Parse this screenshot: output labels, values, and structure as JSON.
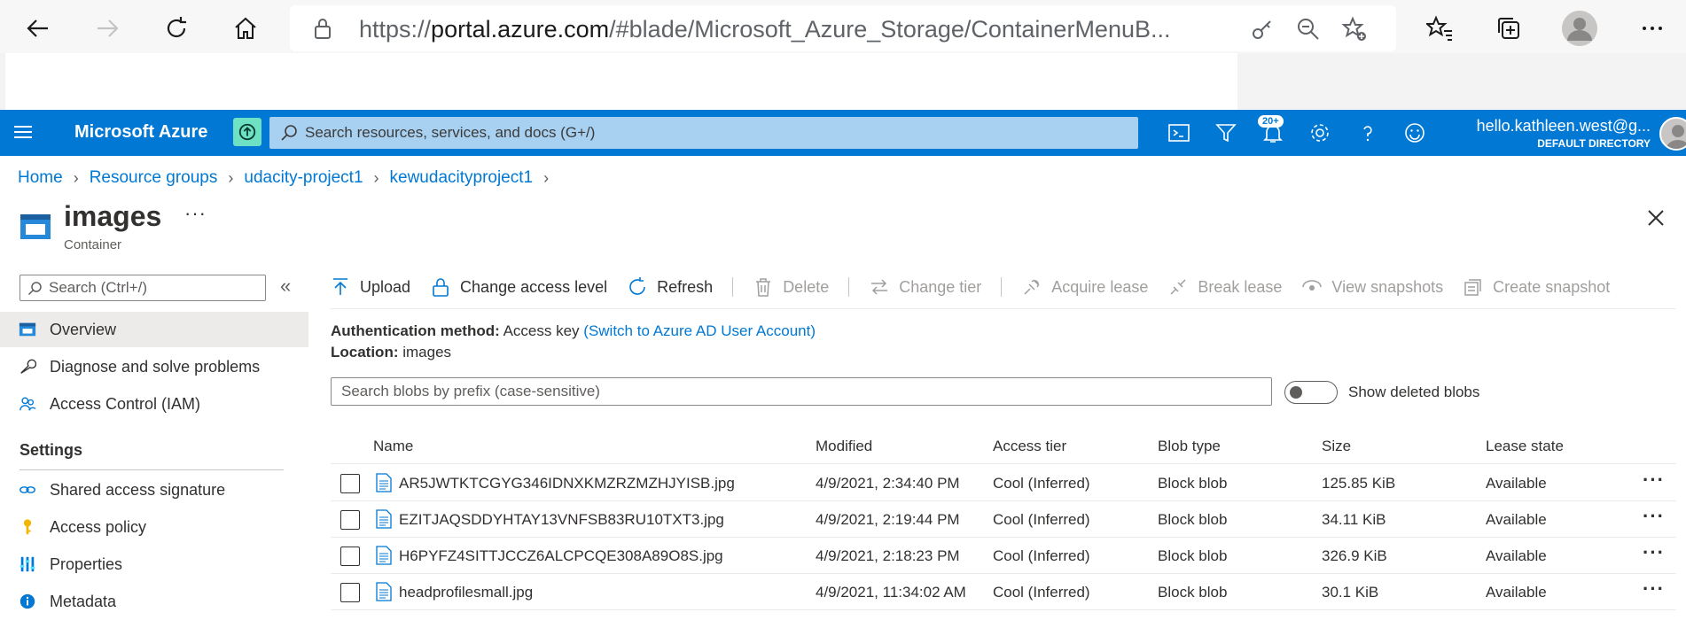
{
  "browser": {
    "url_prefix": "https://",
    "url_host": "portal.azure.com",
    "url_rest": "/#blade/Microsoft_Azure_Storage/ContainerMenuB..."
  },
  "header": {
    "brand": "Microsoft Azure",
    "search_placeholder": "Search resources, services, and docs (G+/)",
    "notification_count": "20+",
    "email": "hello.kathleen.west@g...",
    "directory": "DEFAULT DIRECTORY"
  },
  "breadcrumb": [
    "Home",
    "Resource groups",
    "udacity-project1",
    "kewudacityproject1"
  ],
  "page": {
    "title": "images",
    "subtitle": "Container",
    "more": "···"
  },
  "nav": {
    "search_placeholder": "Search (Ctrl+/)",
    "collapse": "«",
    "items": [
      {
        "label": "Overview",
        "icon": "container-icon"
      },
      {
        "label": "Diagnose and solve problems",
        "icon": "wrench-icon"
      },
      {
        "label": "Access Control (IAM)",
        "icon": "people-icon"
      }
    ],
    "section": "Settings",
    "settings_items": [
      {
        "label": "Shared access signature",
        "icon": "link-icon"
      },
      {
        "label": "Access policy",
        "icon": "key-icon"
      },
      {
        "label": "Properties",
        "icon": "properties-icon"
      },
      {
        "label": "Metadata",
        "icon": "info-icon"
      }
    ]
  },
  "toolbar": {
    "upload": "Upload",
    "change_access": "Change access level",
    "refresh": "Refresh",
    "delete": "Delete",
    "change_tier": "Change tier",
    "acquire_lease": "Acquire lease",
    "break_lease": "Break lease",
    "view_snapshots": "View snapshots",
    "create_snapshot": "Create snapshot"
  },
  "info": {
    "auth_label": "Authentication method:",
    "auth_value": "Access key",
    "auth_link": "(Switch to Azure AD User Account)",
    "location_label": "Location:",
    "location_value": "images"
  },
  "blob_search_placeholder": "Search blobs by prefix (case-sensitive)",
  "show_deleted_label": "Show deleted blobs",
  "table": {
    "columns": [
      "Name",
      "Modified",
      "Access tier",
      "Blob type",
      "Size",
      "Lease state"
    ],
    "rows": [
      {
        "name": "AR5JWTKTCGYG346IDNXKMZRZMZHJYISB.jpg",
        "modified": "4/9/2021, 2:34:40 PM",
        "tier": "Cool (Inferred)",
        "type": "Block blob",
        "size": "125.85 KiB",
        "lease": "Available"
      },
      {
        "name": "EZITJAQSDDYHTAY13VNFSB83RU10TXT3.jpg",
        "modified": "4/9/2021, 2:19:44 PM",
        "tier": "Cool (Inferred)",
        "type": "Block blob",
        "size": "34.11 KiB",
        "lease": "Available"
      },
      {
        "name": "H6PYFZ4SITTJCCZ6ALCPCQE308A89O8S.jpg",
        "modified": "4/9/2021, 2:18:23 PM",
        "tier": "Cool (Inferred)",
        "type": "Block blob",
        "size": "326.9 KiB",
        "lease": "Available"
      },
      {
        "name": "headprofilesmall.jpg",
        "modified": "4/9/2021, 11:34:02 AM",
        "tier": "Cool (Inferred)",
        "type": "Block blob",
        "size": "30.1 KiB",
        "lease": "Available"
      }
    ],
    "row_more": "···"
  },
  "colors": {
    "azure_blue": "#0078d4",
    "header_search": "#a8d1f1"
  }
}
